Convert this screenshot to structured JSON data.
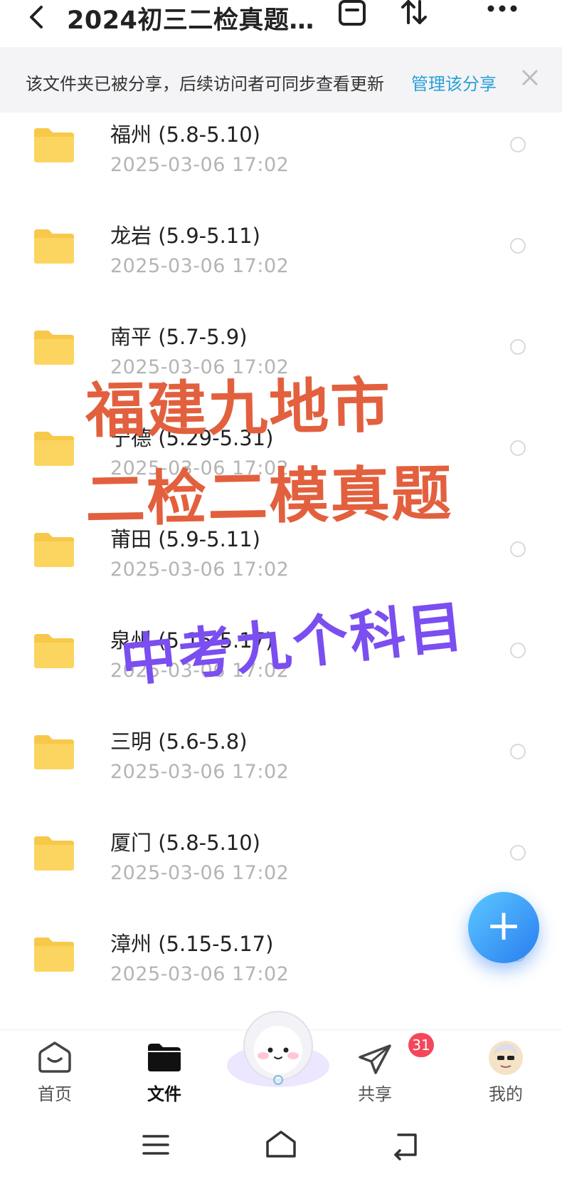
{
  "header": {
    "title": "2024初三二检真题…",
    "back_icon": "back-arrow-icon",
    "icons": [
      "minimize-window-icon",
      "sort-icon",
      "more-icon"
    ]
  },
  "banner": {
    "text": "该文件夹已被分享，后续访问者可同步查看更新",
    "link": "管理该分享"
  },
  "files": [
    {
      "name": "福州 (5.8-5.10)",
      "date": "2025-03-06  17:02"
    },
    {
      "name": "龙岩 (5.9-5.11)",
      "date": "2025-03-06  17:02"
    },
    {
      "name": "南平 (5.7-5.9)",
      "date": "2025-03-06  17:02"
    },
    {
      "name": "宁德 (5.29-5.31)",
      "date": "2025-03-06  17:02"
    },
    {
      "name": "莆田 (5.9-5.11)",
      "date": "2025-03-06  17:02"
    },
    {
      "name": "泉州 (5.15-5.17)",
      "date": "2025-03-06  17:02"
    },
    {
      "name": "三明 (5.6-5.8)",
      "date": "2025-03-06  17:02"
    },
    {
      "name": "厦门 (5.8-5.10)",
      "date": "2025-03-06  17:02"
    },
    {
      "name": "漳州 (5.15-5.17)",
      "date": "2025-03-06  17:02"
    }
  ],
  "overlay": {
    "line1": "福建九地市",
    "line2": "二检二模真题",
    "line3": "中考九个科目",
    "color_main": "#e2603e",
    "color_accent": "#7b4ef0"
  },
  "fab": {
    "label": "+"
  },
  "tabbar": {
    "tabs": [
      {
        "label": "首页",
        "icon": "home-icon"
      },
      {
        "label": "文件",
        "icon": "folder-icon",
        "active": true
      },
      {
        "label": "共享",
        "icon": "share-send-icon",
        "badge": "31"
      },
      {
        "label": "我的",
        "icon": "avatar-icon"
      }
    ]
  },
  "system_nav": {
    "icons": [
      "menu-icon",
      "home-icon",
      "back-icon"
    ]
  }
}
